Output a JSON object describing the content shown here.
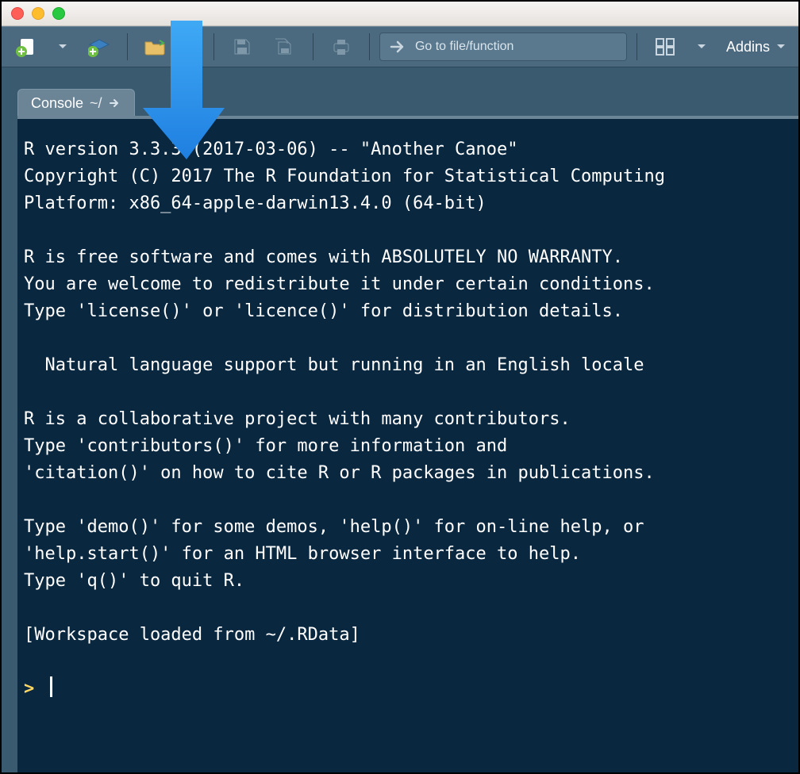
{
  "toolbar": {
    "goto_placeholder": "Go to file/function",
    "addins_label": "Addins"
  },
  "tabs": {
    "console_label": "Console",
    "console_wd": "~/"
  },
  "console": {
    "lines": [
      "R version 3.3.3 (2017-03-06) -- \"Another Canoe\"",
      "Copyright (C) 2017 The R Foundation for Statistical Computing",
      "Platform: x86_64-apple-darwin13.4.0 (64-bit)",
      "",
      "R is free software and comes with ABSOLUTELY NO WARRANTY.",
      "You are welcome to redistribute it under certain conditions.",
      "Type 'license()' or 'licence()' for distribution details.",
      "",
      "  Natural language support but running in an English locale",
      "",
      "R is a collaborative project with many contributors.",
      "Type 'contributors()' for more information and",
      "'citation()' on how to cite R or R packages in publications.",
      "",
      "Type 'demo()' for some demos, 'help()' for on-line help, or",
      "'help.start()' for an HTML browser interface to help.",
      "Type 'q()' to quit R.",
      "",
      "[Workspace loaded from ~/.RData]",
      ""
    ],
    "prompt": ">"
  }
}
